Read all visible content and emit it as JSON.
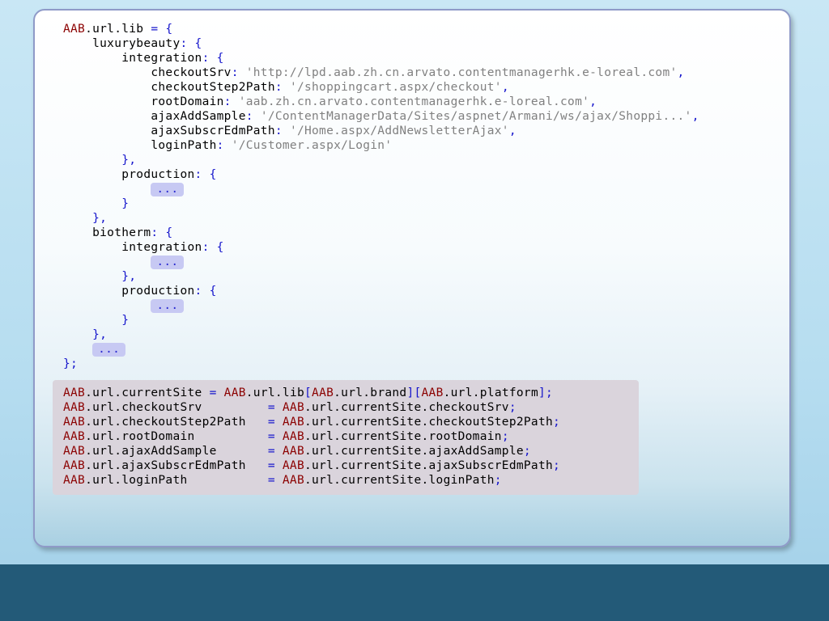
{
  "colors": {
    "background": "#c9e7f5",
    "footer_bar": "#235a78",
    "card_border": "#8f9ac8",
    "keyword": "#8b0000",
    "punctuation": "#1515cc",
    "string": "#808080",
    "ellipsis_bg": "#c7c9f3",
    "code_block_bg": "#dad4dc"
  },
  "code_top": {
    "lines": [
      [
        {
          "t": "AAB",
          "c": "kw"
        },
        {
          "t": ".url.lib ",
          "c": "ident"
        },
        {
          "t": "= {",
          "c": "punc"
        }
      ],
      [
        {
          "t": "    luxurybeauty",
          "c": "ident"
        },
        {
          "t": ": {",
          "c": "punc"
        }
      ],
      [
        {
          "t": "        integration",
          "c": "ident"
        },
        {
          "t": ": {",
          "c": "punc"
        }
      ],
      [
        {
          "t": "            checkoutSrv",
          "c": "ident"
        },
        {
          "t": ": ",
          "c": "punc"
        },
        {
          "t": "'http://lpd.aab.zh.cn.arvato.contentmanagerhk.e-loreal.com'",
          "c": "str"
        },
        {
          "t": ",",
          "c": "punc"
        }
      ],
      [
        {
          "t": "            checkoutStep2Path",
          "c": "ident"
        },
        {
          "t": ": ",
          "c": "punc"
        },
        {
          "t": "'/shoppingcart.aspx/checkout'",
          "c": "str"
        },
        {
          "t": ",",
          "c": "punc"
        }
      ],
      [
        {
          "t": "            rootDomain",
          "c": "ident"
        },
        {
          "t": ": ",
          "c": "punc"
        },
        {
          "t": "'aab.zh.cn.arvato.contentmanagerhk.e-loreal.com'",
          "c": "str"
        },
        {
          "t": ",",
          "c": "punc"
        }
      ],
      [
        {
          "t": "            ajaxAddSample",
          "c": "ident"
        },
        {
          "t": ": ",
          "c": "punc"
        },
        {
          "t": "'/ContentManagerData/Sites/aspnet/Armani/ws/ajax/Shoppi...'",
          "c": "str"
        },
        {
          "t": ",",
          "c": "punc"
        }
      ],
      [
        {
          "t": "            ajaxSubscrEdmPath",
          "c": "ident"
        },
        {
          "t": ": ",
          "c": "punc"
        },
        {
          "t": "'/Home.aspx/AddNewsletterAjax'",
          "c": "str"
        },
        {
          "t": ",",
          "c": "punc"
        }
      ],
      [
        {
          "t": "            loginPath",
          "c": "ident"
        },
        {
          "t": ": ",
          "c": "punc"
        },
        {
          "t": "'/Customer.aspx/Login'",
          "c": "str"
        }
      ],
      [
        {
          "t": "        },",
          "c": "punc"
        }
      ],
      [
        {
          "t": "        production",
          "c": "ident"
        },
        {
          "t": ": {",
          "c": "punc"
        }
      ],
      [
        {
          "t": "            ",
          "c": "ident"
        },
        {
          "t": "...",
          "c": "ellipsis"
        }
      ],
      [
        {
          "t": "        }",
          "c": "punc"
        }
      ],
      [
        {
          "t": "    },",
          "c": "punc"
        }
      ],
      [
        {
          "t": "    biotherm",
          "c": "ident"
        },
        {
          "t": ": {",
          "c": "punc"
        }
      ],
      [
        {
          "t": "        integration",
          "c": "ident"
        },
        {
          "t": ": {",
          "c": "punc"
        }
      ],
      [
        {
          "t": "            ",
          "c": "ident"
        },
        {
          "t": "...",
          "c": "ellipsis"
        }
      ],
      [
        {
          "t": "        },",
          "c": "punc"
        }
      ],
      [
        {
          "t": "        production",
          "c": "ident"
        },
        {
          "t": ": {",
          "c": "punc"
        }
      ],
      [
        {
          "t": "            ",
          "c": "ident"
        },
        {
          "t": "...",
          "c": "ellipsis"
        }
      ],
      [
        {
          "t": "        }",
          "c": "punc"
        }
      ],
      [
        {
          "t": "    },",
          "c": "punc"
        }
      ],
      [
        {
          "t": "    ",
          "c": "ident"
        },
        {
          "t": "...",
          "c": "ellipsis"
        }
      ],
      [
        {
          "t": "};",
          "c": "punc"
        }
      ]
    ]
  },
  "code_bottom": {
    "lines": [
      [
        {
          "t": "AAB",
          "c": "kw"
        },
        {
          "t": ".url.currentSite ",
          "c": "ident"
        },
        {
          "t": "= ",
          "c": "punc"
        },
        {
          "t": "AAB",
          "c": "kw"
        },
        {
          "t": ".url.lib",
          "c": "ident"
        },
        {
          "t": "[",
          "c": "punc"
        },
        {
          "t": "AAB",
          "c": "kw"
        },
        {
          "t": ".url.brand",
          "c": "ident"
        },
        {
          "t": "][",
          "c": "punc"
        },
        {
          "t": "AAB",
          "c": "kw"
        },
        {
          "t": ".url.platform",
          "c": "ident"
        },
        {
          "t": "];",
          "c": "punc"
        }
      ],
      [
        {
          "t": "AAB",
          "c": "kw"
        },
        {
          "t": ".url.checkoutSrv         ",
          "c": "ident"
        },
        {
          "t": "= ",
          "c": "punc"
        },
        {
          "t": "AAB",
          "c": "kw"
        },
        {
          "t": ".url.currentSite.checkoutSrv",
          "c": "ident"
        },
        {
          "t": ";",
          "c": "punc"
        }
      ],
      [
        {
          "t": "AAB",
          "c": "kw"
        },
        {
          "t": ".url.checkoutStep2Path   ",
          "c": "ident"
        },
        {
          "t": "= ",
          "c": "punc"
        },
        {
          "t": "AAB",
          "c": "kw"
        },
        {
          "t": ".url.currentSite.checkoutStep2Path",
          "c": "ident"
        },
        {
          "t": ";",
          "c": "punc"
        }
      ],
      [
        {
          "t": "AAB",
          "c": "kw"
        },
        {
          "t": ".url.rootDomain          ",
          "c": "ident"
        },
        {
          "t": "= ",
          "c": "punc"
        },
        {
          "t": "AAB",
          "c": "kw"
        },
        {
          "t": ".url.currentSite.rootDomain",
          "c": "ident"
        },
        {
          "t": ";",
          "c": "punc"
        }
      ],
      [
        {
          "t": "AAB",
          "c": "kw"
        },
        {
          "t": ".url.ajaxAddSample       ",
          "c": "ident"
        },
        {
          "t": "= ",
          "c": "punc"
        },
        {
          "t": "AAB",
          "c": "kw"
        },
        {
          "t": ".url.currentSite.ajaxAddSample",
          "c": "ident"
        },
        {
          "t": ";",
          "c": "punc"
        }
      ],
      [
        {
          "t": "AAB",
          "c": "kw"
        },
        {
          "t": ".url.ajaxSubscrEdmPath   ",
          "c": "ident"
        },
        {
          "t": "= ",
          "c": "punc"
        },
        {
          "t": "AAB",
          "c": "kw"
        },
        {
          "t": ".url.currentSite.ajaxSubscrEdmPath",
          "c": "ident"
        },
        {
          "t": ";",
          "c": "punc"
        }
      ],
      [
        {
          "t": "AAB",
          "c": "kw"
        },
        {
          "t": ".url.loginPath           ",
          "c": "ident"
        },
        {
          "t": "= ",
          "c": "punc"
        },
        {
          "t": "AAB",
          "c": "kw"
        },
        {
          "t": ".url.currentSite.loginPath",
          "c": "ident"
        },
        {
          "t": ";",
          "c": "punc"
        }
      ]
    ]
  }
}
